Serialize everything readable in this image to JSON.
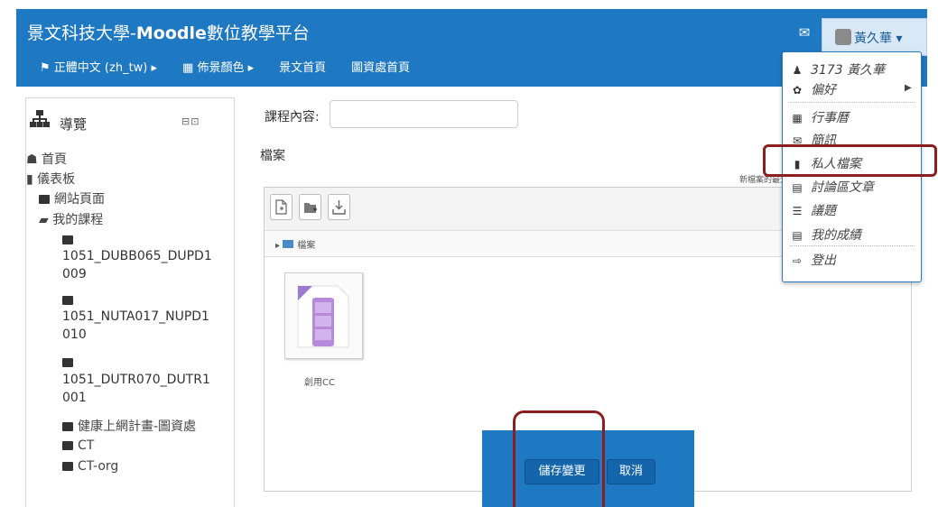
{
  "header": {
    "site_title_prefix": "景文科技大學-",
    "site_title_brand": "Moodle",
    "site_title_suffix": "數位教學平台",
    "menu": [
      {
        "label": "正體中文 (zh_tw)"
      },
      {
        "label": "佈景顏色"
      },
      {
        "label": "景文首頁"
      },
      {
        "label": "圖資處首頁"
      }
    ],
    "user_name": "黃久華",
    "brand_color": "#1e78c2"
  },
  "nav": {
    "title": "導覽",
    "items": {
      "home": "首頁",
      "dashboard": "儀表板",
      "site_pages": "網站頁面",
      "my_courses": "我的課程",
      "course1_a": "1051_DUBB065_DUPD1",
      "course1_b": "009",
      "course2_a": "1051_NUTA017_NUPD1",
      "course2_b": "010",
      "course3_a": "1051_DUTR070_DUTR1",
      "course3_b": "001",
      "health": "健康上網計畫-圖資處",
      "ct": "CT",
      "ct_org": "CT-org"
    }
  },
  "main": {
    "course_content_label": "課程內容:",
    "course_content_value": "",
    "files_label": "檔案",
    "max_size_note": "新檔案的最大",
    "path_label": "檔案",
    "file_name": "創用CC",
    "save_label": "儲存變更",
    "cancel_label": "取消"
  },
  "dropdown": {
    "user_line": "3173 黃久華",
    "items": {
      "preferences": "偏好",
      "calendar": "行事曆",
      "messages": "簡訊",
      "private_files": "私人檔案",
      "forum_posts": "討論區文章",
      "discussions": "議題",
      "grades": "我的成績",
      "logout": "登出"
    }
  },
  "highlight_color": "#8b1f1f"
}
